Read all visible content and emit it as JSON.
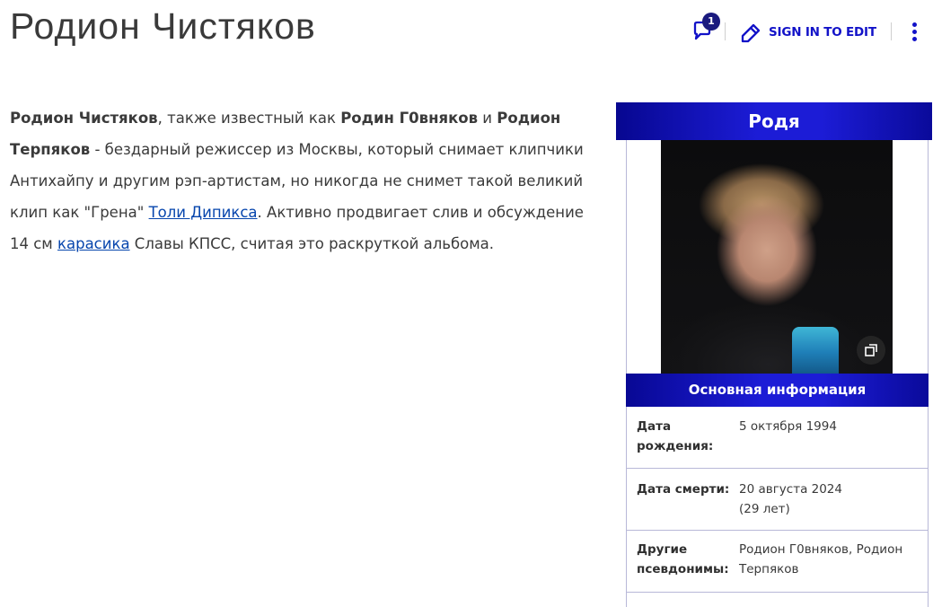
{
  "page": {
    "title": "Родион Чистяков"
  },
  "actions": {
    "comments_count": "1",
    "edit_label": "SIGN IN TO EDIT"
  },
  "article": {
    "name_bold": "Родион Чистяков",
    "text_1": ", также известный как ",
    "alias_1_bold": "Родин Г0вняков",
    "text_2": " и ",
    "alias_2_bold": "Родион Терпяков",
    "text_3": " - бездарный режиссер из Москвы, который снимает клипчики Антихайпу и другим рэп-артистам, но никогда не снимет такой великий клип как \"Грена\" ",
    "link_1": "Толи Дипикса",
    "text_4": ". Активно продвигает слив и обсуждение 14 см ",
    "link_2": "карасика",
    "text_5": " Славы КПСС, считая это раскруткой альбома."
  },
  "infobox": {
    "title": "Родя",
    "section_header": "Основная информация",
    "rows": [
      {
        "label": "Дата рождения:",
        "value": "5 октября 1994"
      },
      {
        "label": "Дата смерти:",
        "value": "20 августа 2024 (29 лет)"
      },
      {
        "label": "Другие псевдонимы:",
        "value": "Родион Г0вняков, Родион Терпяков"
      }
    ]
  },
  "colors": {
    "accent_blue": "#1212c8",
    "infobox_gradient_dark": "#070790",
    "infobox_gradient_light": "#1c1cd6",
    "link": "#0645ad"
  }
}
